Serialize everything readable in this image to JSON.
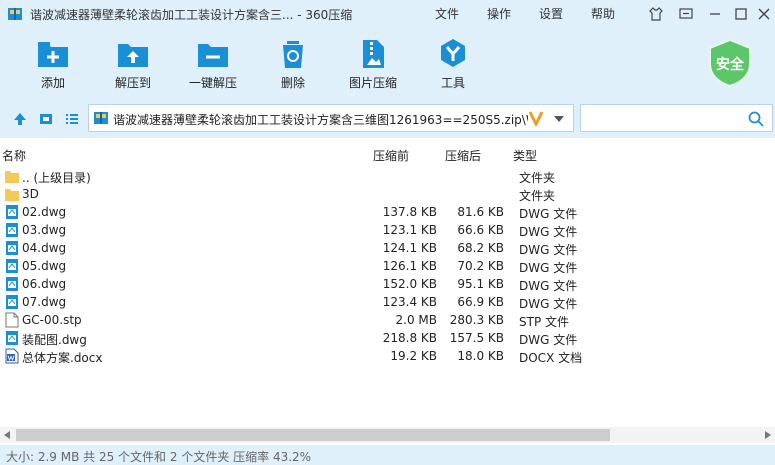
{
  "window": {
    "title": "谐波减速器薄壁柔轮滚齿加工工装设计方案含三... - 360压缩",
    "menu": [
      "文件",
      "操作",
      "设置",
      "帮助"
    ]
  },
  "toolbar": {
    "add": "添加",
    "extract_to": "解压到",
    "one_click_extract": "一键解压",
    "delete": "删除",
    "image_compress": "图片压缩",
    "tools": "工具",
    "security_badge": "安全"
  },
  "pathbar": {
    "path": "谐波减速器薄壁柔轮滚齿加工工装设计方案含三维图1261963==250S5.zip\\W",
    "search_placeholder": ""
  },
  "columns": {
    "name": "名称",
    "compressed": "压缩前",
    "original": "压缩后",
    "type": "类型"
  },
  "files": [
    {
      "name": ".. (上级目录)",
      "compressed": "",
      "original": "",
      "type": "文件夹",
      "icon": "folder-icon"
    },
    {
      "name": "3D",
      "compressed": "",
      "original": "",
      "type": "文件夹",
      "icon": "folder-icon"
    },
    {
      "name": "02.dwg",
      "compressed": "137.8 KB",
      "original": "81.6 KB",
      "type": "DWG 文件",
      "icon": "dwg-file-icon"
    },
    {
      "name": "03.dwg",
      "compressed": "123.1 KB",
      "original": "66.6 KB",
      "type": "DWG 文件",
      "icon": "dwg-file-icon"
    },
    {
      "name": "04.dwg",
      "compressed": "124.1 KB",
      "original": "68.2 KB",
      "type": "DWG 文件",
      "icon": "dwg-file-icon"
    },
    {
      "name": "05.dwg",
      "compressed": "126.1 KB",
      "original": "70.2 KB",
      "type": "DWG 文件",
      "icon": "dwg-file-icon"
    },
    {
      "name": "06.dwg",
      "compressed": "152.0 KB",
      "original": "95.1 KB",
      "type": "DWG 文件",
      "icon": "dwg-file-icon"
    },
    {
      "name": "07.dwg",
      "compressed": "123.4 KB",
      "original": "66.9 KB",
      "type": "DWG 文件",
      "icon": "dwg-file-icon"
    },
    {
      "name": "GC-00.stp",
      "compressed": "2.0 MB",
      "original": "280.3 KB",
      "type": "STP 文件",
      "icon": "generic-file-icon"
    },
    {
      "name": "装配图.dwg",
      "compressed": "218.8 KB",
      "original": "157.5 KB",
      "type": "DWG 文件",
      "icon": "dwg-file-icon"
    },
    {
      "name": "总体方案.docx",
      "compressed": "19.2 KB",
      "original": "18.0 KB",
      "type": "DOCX 文档",
      "icon": "docx-file-icon"
    }
  ],
  "status": "大小: 2.9 MB 共 25 个文件和 2 个文件夹 压缩率 43.2%",
  "colors": {
    "chrome": "#dff0fb",
    "accent": "#1a8fd6",
    "folder": "#f5c85a",
    "shield": "#5cc76a"
  }
}
